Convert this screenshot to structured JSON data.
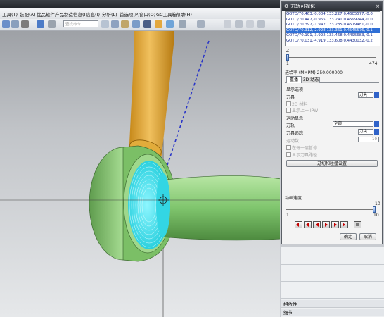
{
  "menubar": {
    "items": [
      "工具(T)",
      "装配(A)",
      "优品软件",
      "产品制造信息(I)",
      "信息(I)",
      "分析(L)",
      "首选项(P)",
      "窗口(O)",
      "GC工具箱",
      "帮助(H)"
    ]
  },
  "toolbar": {
    "search_placeholder": "查找命令"
  },
  "dialog": {
    "title": "刀轨可视化",
    "path_lines": [
      "GOTO/70.463,-0.004,133.227,0.4605577,-0.0",
      "GOTO/70.447,-0.965,133.241,0.4599244,-0.0",
      "GOTO/70.397,-1.942,133.285,0.4579481,-0.0",
      "GOTO/70.312,-2.928,133.361,0.4545576,-0.1",
      "GOTO/70.191,-3.922,133.468,0.4495683,-0.1",
      "GOTO/70.031,-4.919,133.608,0.4430032,-0.2"
    ],
    "selected_index": 3,
    "slider_z": {
      "label": "Z",
      "min": "1",
      "max": "474",
      "value": 0.0
    },
    "feed_rate": "进给率 (MMPM) 250.000000",
    "tabs": [
      "重播",
      "3D 动态"
    ],
    "display_options": "显示选项",
    "tool_label": "刀具",
    "tool_value": "刀具",
    "2d_material": "2D 材料",
    "show_prev_ipw": "显示上一 IPW",
    "motion_display": "运动显示",
    "tool_path_label": "刀轨",
    "tool_path_value": "全部",
    "tool_trace_label": "刀具追踪",
    "tool_trace_value": "刀尖",
    "motion_count_label": "运动数",
    "motion_count_value": "10",
    "check_after_gouge": "在每一层暂停",
    "show_ipw": "显示刀具路径",
    "filter_button": "过切和碰撞设置",
    "anim_speed_label": "动画速度",
    "anim_speed": {
      "min": "1",
      "max": "10",
      "value": 10
    },
    "ok": "确定",
    "cancel": "取消"
  },
  "bottom_panel": {
    "rows": [
      "",
      "",
      "",
      "",
      "",
      ""
    ],
    "dependency": "相依性",
    "details": "细节"
  },
  "colors": {
    "shaft": "#d69d1e",
    "part": "#8ed07e",
    "toolpath": "#29e2ee",
    "cutline": "#2a36c8"
  }
}
